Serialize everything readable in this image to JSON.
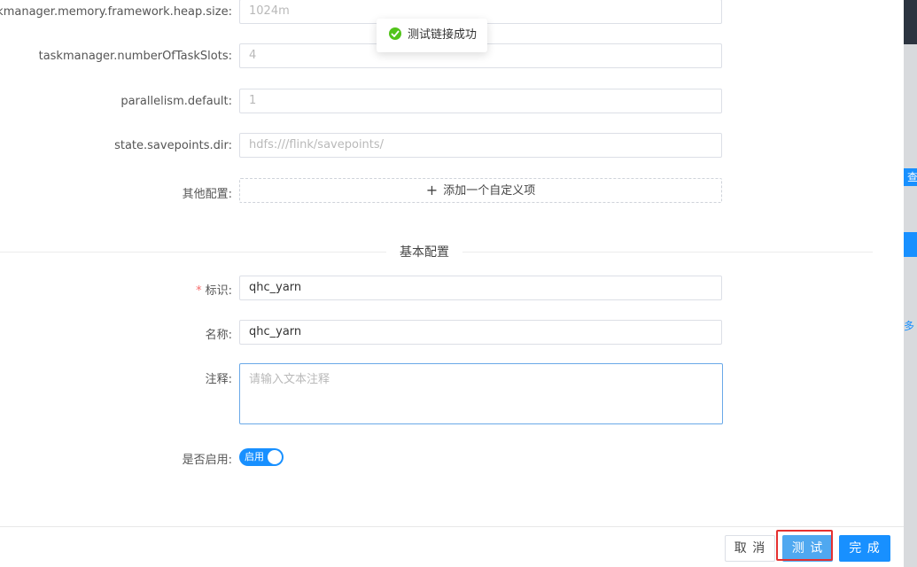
{
  "toast": {
    "message": "测试链接成功"
  },
  "flink_fields": [
    {
      "label": "taskmanager.memory.framework.heap.size:",
      "placeholder": "1024m"
    },
    {
      "label": "taskmanager.numberOfTaskSlots:",
      "placeholder": "4"
    },
    {
      "label": "parallelism.default:",
      "placeholder": "1"
    },
    {
      "label": "state.savepoints.dir:",
      "placeholder": "hdfs:///flink/savepoints/"
    }
  ],
  "other_config": {
    "label": "其他配置:",
    "add_button": "添加一个自定义项"
  },
  "basic_section": {
    "title": "基本配置"
  },
  "basic_fields": {
    "id_label": "标识:",
    "id_required_mark": "*",
    "id_value": "qhc_yarn",
    "name_label": "名称:",
    "name_value": "qhc_yarn",
    "note_label": "注释:",
    "note_placeholder": "请输入文本注释",
    "enabled_label": "是否启用:",
    "enabled_switch_text": "启用",
    "enabled_value": true
  },
  "footer": {
    "cancel": "取 消",
    "test": "测 试",
    "done": "完 成"
  },
  "background_peek": {
    "a": "查",
    "b": "多"
  },
  "colors": {
    "primary": "#1890ff",
    "success": "#52c41a",
    "required": "#f56c6c",
    "highlight_border": "#e53030"
  },
  "icons": {
    "toast": "check-circle-icon",
    "add": "plus-icon"
  }
}
